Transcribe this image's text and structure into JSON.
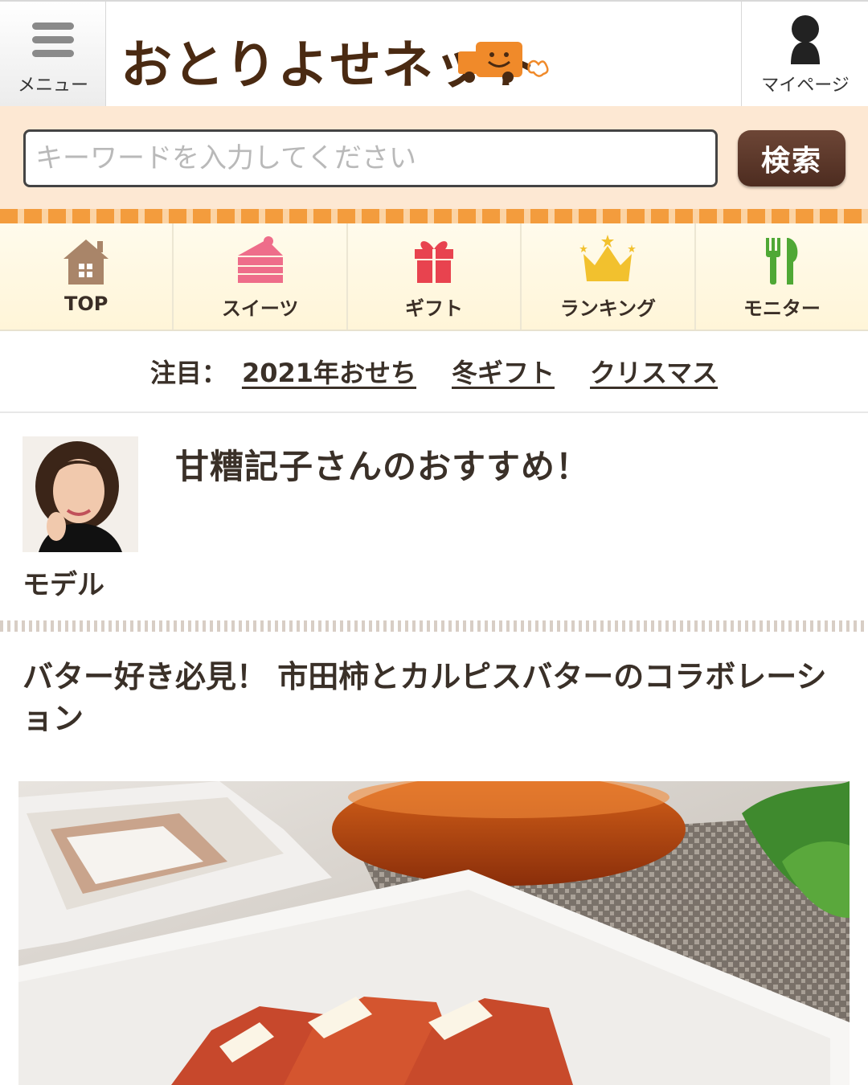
{
  "header": {
    "menu_label": "メニュー",
    "logo_text": "おとりよせネット",
    "mypage_label": "マイページ"
  },
  "search": {
    "placeholder": "キーワードを入力してください",
    "button_label": "検索"
  },
  "categories": [
    {
      "label": "TOP",
      "icon": "house-icon"
    },
    {
      "label": "スイーツ",
      "icon": "cake-icon"
    },
    {
      "label": "ギフト",
      "icon": "gift-icon"
    },
    {
      "label": "ランキング",
      "icon": "crown-icon"
    },
    {
      "label": "モニター",
      "icon": "fork-knife-icon"
    }
  ],
  "featured": {
    "prefix": "注目：",
    "links": [
      "2021年おせち",
      "冬ギフト",
      "クリスマス"
    ]
  },
  "profile": {
    "heading": "甘糟記子さんのおすすめ！",
    "role": "モデル"
  },
  "article": {
    "title": "バター好き必見！ 市田柿とカルピスバターのコラボレーション"
  },
  "colors": {
    "brand_brown": "#4a2a12",
    "accent_orange": "#f39c3d",
    "search_band": "#fde8d3",
    "search_button": "#5a3628"
  }
}
